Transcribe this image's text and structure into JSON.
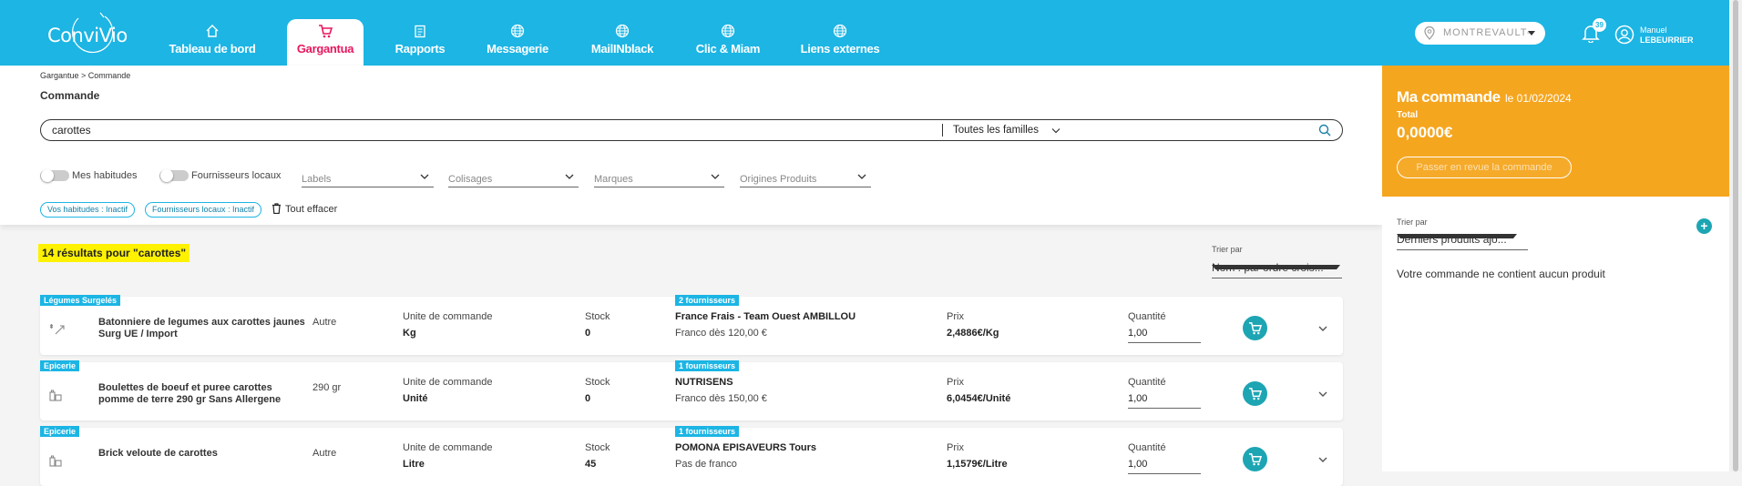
{
  "brand": {
    "name": "ConviVio"
  },
  "nav": {
    "tabs": [
      {
        "label": "Tableau de bord",
        "icon": "home-icon"
      },
      {
        "label": "Gargantua",
        "icon": "cart-icon"
      },
      {
        "label": "Rapports",
        "icon": "clipboard-icon"
      },
      {
        "label": "Messagerie",
        "icon": "globe-icon"
      },
      {
        "label": "MailINblack",
        "icon": "globe-icon"
      },
      {
        "label": "Clic & Miam",
        "icon": "globe-icon"
      },
      {
        "label": "Liens externes",
        "icon": "globe-icon"
      }
    ],
    "active_tab": "Gargantua"
  },
  "header": {
    "location": "MONTREVAULT-",
    "notifications_count": "39",
    "user_first": "Manuel",
    "user_last": "LEBEURRIER"
  },
  "breadcrumb": "Gargantue > Commande",
  "page_title": "Commande",
  "search": {
    "value": "carottes",
    "family": "Toutes les familles"
  },
  "filters": {
    "toggles": [
      {
        "label": "Mes habitudes"
      },
      {
        "label": "Fournisseurs locaux"
      }
    ],
    "dropdowns": [
      {
        "label": "Labels"
      },
      {
        "label": "Colisages"
      },
      {
        "label": "Marques"
      },
      {
        "label": "Origines Produits"
      }
    ],
    "chips": [
      {
        "label": "Vos habitudes : Inactif"
      },
      {
        "label": "Fournisseurs locaux : Inactif"
      }
    ],
    "clear_label": "Tout effacer"
  },
  "results": {
    "count_text": "14 résultats pour \"carottes\"",
    "sort_label": "Trier par",
    "sort_value": "Nom : par ordre crois..."
  },
  "column_labels": {
    "unit": "Unite de commande",
    "stock": "Stock",
    "price": "Prix",
    "qty": "Quantité"
  },
  "products": [
    {
      "category": "Légumes Surgelés",
      "name": "Batonniere de legumes aux carottes jaunes Surg UE / Import",
      "packaging": "Autre",
      "order_unit": "Kg",
      "stock": "0",
      "suppliers_badge": "2 fournisseurs",
      "supplier": "France Frais - Team Ouest AMBILLOU",
      "franco": "Franco dès 120,00 €",
      "price": "2,4886€/Kg",
      "quantity": "1,00"
    },
    {
      "category": "Epicerie",
      "name": "Boulettes de boeuf et puree carottes pomme de terre 290 gr Sans Allergene",
      "packaging": "290 gr",
      "order_unit": "Unité",
      "stock": "0",
      "suppliers_badge": "1 fournisseurs",
      "supplier": "NUTRISENS",
      "franco": "Franco dès 150,00 €",
      "price": "6,0454€/Unité",
      "quantity": "1,00"
    },
    {
      "category": "Epicerie",
      "name": "Brick veloute de carottes",
      "packaging": "Autre",
      "order_unit": "Litre",
      "stock": "45",
      "suppliers_badge": "1 fournisseurs",
      "supplier": "POMONA EPISAVEURS Tours",
      "franco": "Pas de franco",
      "price": "1,1579€/Litre",
      "quantity": "1,00"
    }
  ],
  "order": {
    "title": "Ma commande",
    "date": "le 01/02/2024",
    "total_label": "Total",
    "total": "0,0000€",
    "review_button": "Passer en revue la commande",
    "sort_label": "Trier par",
    "sort_value": "Derniers produits ajo...",
    "empty_text": "Votre commande ne contient aucun produit"
  },
  "colors": {
    "primary": "#1cb5e4",
    "accent": "#e8175d",
    "order": "#f5a61f",
    "cart": "#1da5b3",
    "highlight": "#fff200"
  }
}
